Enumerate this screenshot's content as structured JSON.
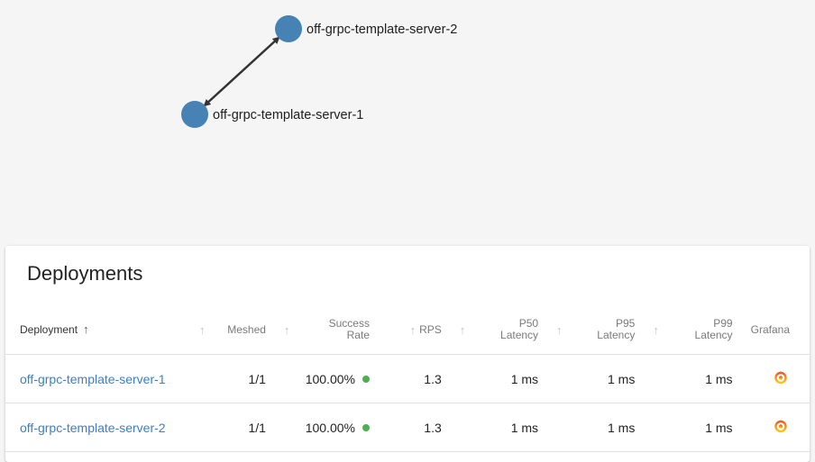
{
  "graph": {
    "nodes": [
      {
        "id": "server-2",
        "label": "off-grpc-template-server-2"
      },
      {
        "id": "server-1",
        "label": "off-grpc-template-server-1"
      }
    ],
    "node_color": "#4682b4",
    "edge_color": "#333333"
  },
  "deployments": {
    "title": "Deployments",
    "columns": {
      "deployment": "Deployment",
      "meshed": "Meshed",
      "success_rate_1": "Success",
      "success_rate_2": "Rate",
      "rps": "RPS",
      "p50_1": "P50",
      "p50_2": "Latency",
      "p95_1": "P95",
      "p95_2": "Latency",
      "p99_1": "P99",
      "p99_2": "Latency",
      "grafana": "Grafana"
    },
    "rows": [
      {
        "name": "off-grpc-template-server-1",
        "meshed": "1/1",
        "success_rate": "100.00%",
        "rps": "1.3",
        "p50": "1 ms",
        "p95": "1 ms",
        "p99": "1 ms"
      },
      {
        "name": "off-grpc-template-server-2",
        "meshed": "1/1",
        "success_rate": "100.00%",
        "rps": "1.3",
        "p50": "1 ms",
        "p95": "1 ms",
        "p99": "1 ms"
      }
    ],
    "status_color": "#4caf50",
    "link_color": "#3a7fcb"
  }
}
